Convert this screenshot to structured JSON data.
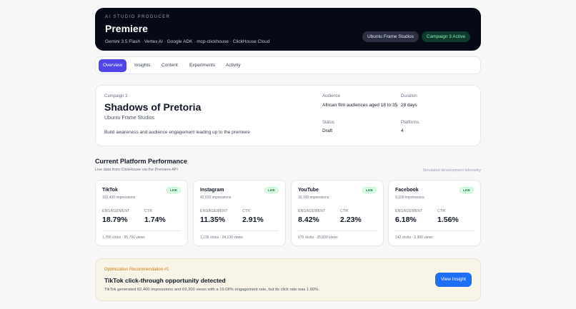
{
  "header": {
    "eyebrow": "AI STUDIO PRODUCER",
    "title": "Premiere",
    "tech": "Gemini 3.5 Flash · Vertex AI · Google ADK · mcp-clickhouse · ClickHouse Cloud",
    "studio_pill": "Ubuntu Frame Studios",
    "status_pill": "Campaign 3 Active"
  },
  "tabs": [
    "Overview",
    "Insights",
    "Content",
    "Experiments",
    "Activity"
  ],
  "active_tab": "Overview",
  "campaign": {
    "label": "Campaign 3",
    "name": "Shadows of Pretoria",
    "studio": "Ubuntu Frame Studios",
    "goal": "Build awareness and audience engagement leading up to the premiere",
    "audience_label": "Audience",
    "audience": "African film audiences aged 18 to 35",
    "duration_label": "Duration",
    "duration": "28 days",
    "status_label": "Status",
    "status": "Draft",
    "platforms_label": "Platforms",
    "platforms": "4"
  },
  "performance": {
    "title": "Current Platform Performance",
    "subtitle": "Live data from ClickHouse via the Premiere API",
    "note": "Simulated development telemetry",
    "engagement_label": "ENGAGEMENT",
    "ctr_label": "CTR",
    "live_label": "LIVE",
    "platforms": [
      {
        "name": "TikTok",
        "impressions": "102,400 impressions",
        "engagement": "18.79%",
        "ctr": "1.74%",
        "footer": "1,780 clicks · 85,790 views"
      },
      {
        "name": "Instagram",
        "impressions": "42,520 impressions",
        "engagement": "11.35%",
        "ctr": "2.91%",
        "footer": "1,236 clicks · 24,130 views"
      },
      {
        "name": "YouTube",
        "impressions": "30,100 impressions",
        "engagement": "8.42%",
        "ctr": "2.23%",
        "footer": "670 clicks · 25,600 views"
      },
      {
        "name": "Facebook",
        "impressions": "9,100 impressions",
        "engagement": "6.18%",
        "ctr": "1.56%",
        "footer": "142 clicks · 3,900 views"
      }
    ]
  },
  "recommendation": {
    "eyebrow": "Optimization Recommendation #1",
    "title": "TikTok click-through opportunity detected",
    "description": "TikTok generated 82,400 impressions and 69,200 views with a 19.08% engagement rate, but its click rate was 1.60%.",
    "button": "View Insight"
  }
}
